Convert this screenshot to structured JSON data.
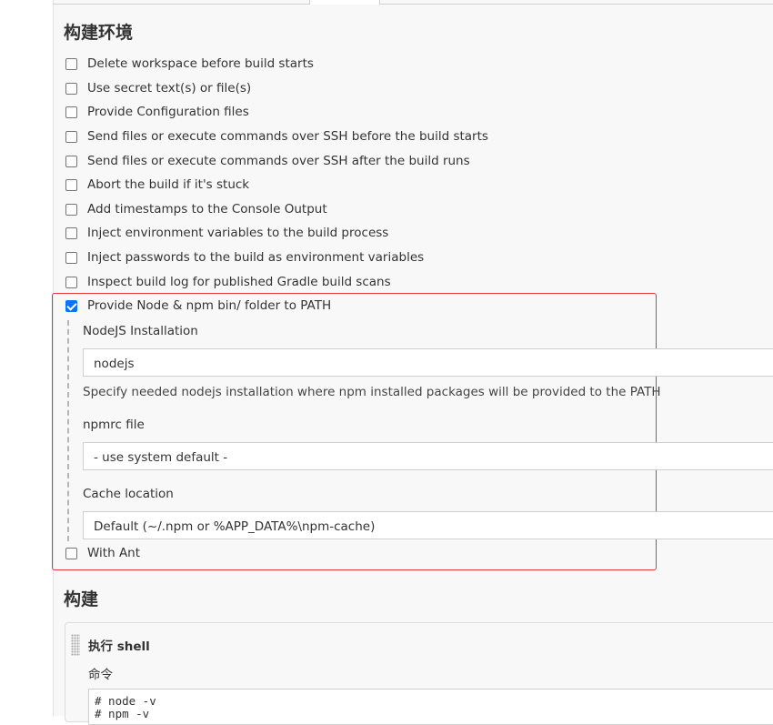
{
  "sections": {
    "build_env_title": "构建环境",
    "build_title": "构建"
  },
  "options": [
    {
      "label": "Delete workspace before build starts",
      "checked": false
    },
    {
      "label": "Use secret text(s) or file(s)",
      "checked": false
    },
    {
      "label": "Provide Configuration files",
      "checked": false
    },
    {
      "label": "Send files or execute commands over SSH before the build starts",
      "checked": false
    },
    {
      "label": "Send files or execute commands over SSH after the build runs",
      "checked": false
    },
    {
      "label": "Abort the build if it's stuck",
      "checked": false
    },
    {
      "label": "Add timestamps to the Console Output",
      "checked": false
    },
    {
      "label": "Inject environment variables to the build process",
      "checked": false
    },
    {
      "label": "Inject passwords to the build as environment variables",
      "checked": false
    },
    {
      "label": "Inspect build log for published Gradle build scans",
      "checked": false
    },
    {
      "label": "Provide Node & npm bin/ folder to PATH",
      "checked": true
    }
  ],
  "node": {
    "installation_label": "NodeJS Installation",
    "installation_value": "nodejs",
    "installation_help": "Specify needed nodejs installation where npm installed packages will be provided to the PATH",
    "npmrc_label": "npmrc file",
    "npmrc_value": "- use system default -",
    "cache_label": "Cache location",
    "cache_value": "Default (~/.npm or %APP_DATA%\\npm-cache)"
  },
  "with_ant": {
    "label": "With Ant",
    "checked": false
  },
  "build_step": {
    "title": "执行 shell",
    "command_label": "命令",
    "command_text": "# node -v\n# npm -v"
  },
  "colors": {
    "highlight_border": "#e53935",
    "checkbox_checked": "#0075ff"
  }
}
